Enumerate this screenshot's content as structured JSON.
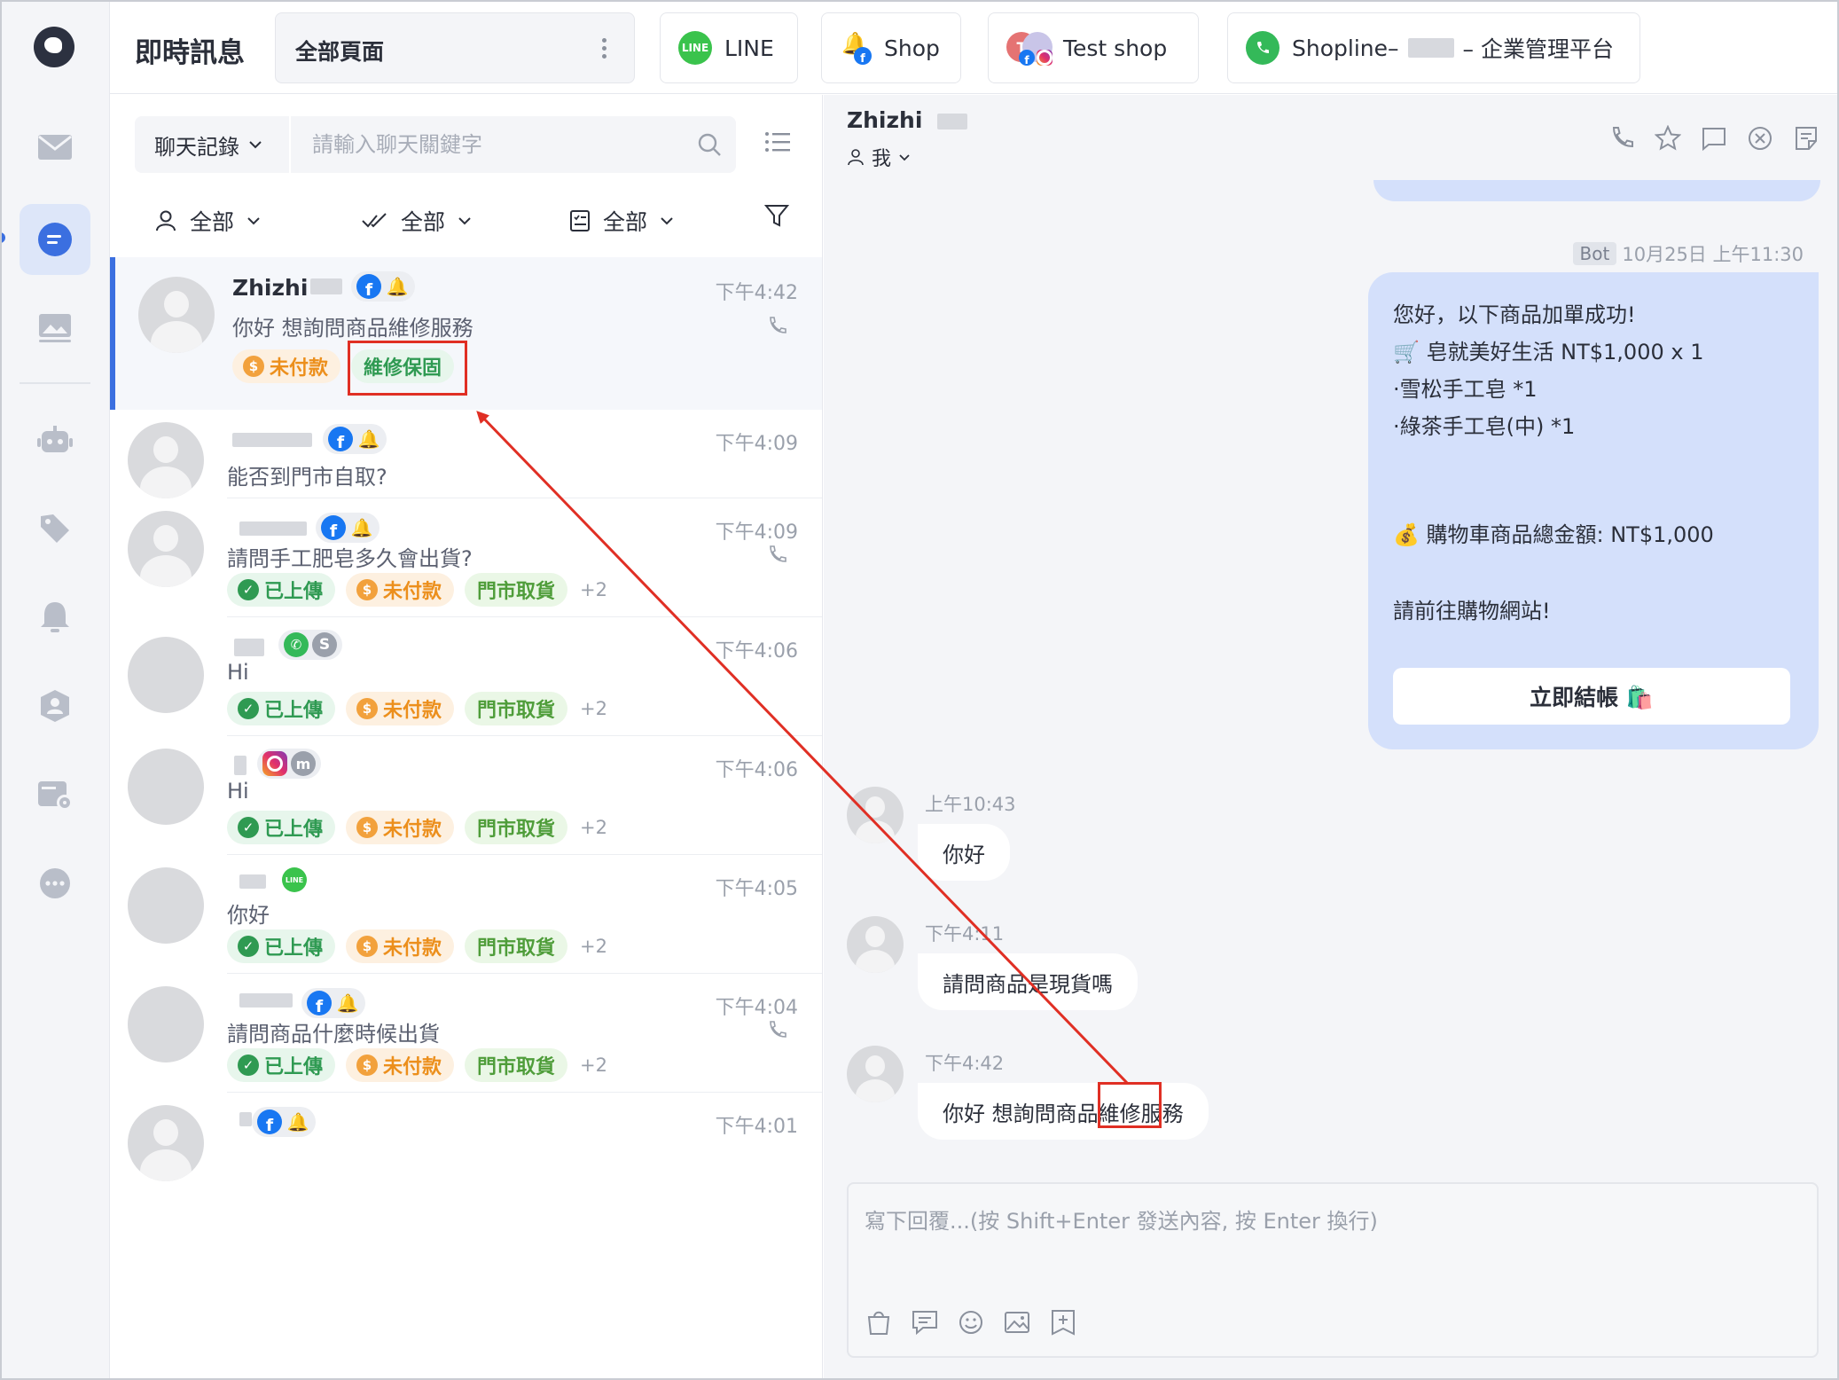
{
  "header": {
    "app_title": "即時訊息",
    "page_selector": "全部頁面",
    "tabs": [
      {
        "label": "LINE"
      },
      {
        "label": "Shop"
      },
      {
        "label": "Test shop"
      },
      {
        "label_prefix": "Shopline–",
        "label_suffix": "– 企業管理平台"
      }
    ]
  },
  "search": {
    "type_label": "聊天記錄",
    "placeholder": "請輸入聊天關鍵字"
  },
  "filters": [
    {
      "label": "全部"
    },
    {
      "label": "全部"
    },
    {
      "label": "全部"
    }
  ],
  "conversations": [
    {
      "name": "Zhizhi",
      "time": "下午4:42",
      "preview": "你好 想詢問商品維修服務",
      "tags": [
        "未付款",
        "維修保固"
      ]
    },
    {
      "name": "",
      "time": "下午4:09",
      "preview": "能否到門市自取?",
      "tags": []
    },
    {
      "name": "",
      "time": "下午4:09",
      "preview": "請問手工肥皂多久會出貨?",
      "tags": [
        "已上傳",
        "未付款",
        "門市取貨"
      ],
      "more": "+2"
    },
    {
      "name": "",
      "time": "下午4:06",
      "preview": "Hi",
      "tags": [
        "已上傳",
        "未付款",
        "門市取貨"
      ],
      "more": "+2"
    },
    {
      "name": "",
      "time": "下午4:06",
      "preview": "Hi",
      "tags": [
        "已上傳",
        "未付款",
        "門市取貨"
      ],
      "more": "+2"
    },
    {
      "name": "",
      "time": "下午4:05",
      "preview": "你好",
      "tags": [
        "已上傳",
        "未付款",
        "門市取貨"
      ],
      "more": "+2"
    },
    {
      "name": "",
      "time": "下午4:04",
      "preview": "請問商品什麼時候出貨",
      "tags": [
        "已上傳",
        "未付款",
        "門市取貨"
      ],
      "more": "+2"
    },
    {
      "name": "",
      "time": "下午4:01",
      "preview": "",
      "tags": []
    }
  ],
  "chat": {
    "contact_name": "Zhizhi",
    "assignee": "我",
    "bot_label": "Bot",
    "bot_time": "10月25日 上午11:30",
    "bot_lines": [
      "您好，以下商品加單成功!",
      "🛒 皂就美好生活 NT$1,000 x 1",
      "·雪松手工皂 *1",
      "·綠茶手工皂(中) *1",
      "💰 購物車商品總金額: NT$1,000",
      "請前往購物網站!"
    ],
    "checkout_button": "立即結帳 🛍️",
    "messages": [
      {
        "time": "上午10:43",
        "text": "你好"
      },
      {
        "time": "下午4:11",
        "text": "請問商品是現貨嗎"
      },
      {
        "time": "下午4:42",
        "text": "你好 想詢問商品維修服務"
      }
    ],
    "composer_placeholder": "寫下回覆...(按 Shift+Enter 發送內容, 按 Enter 換行)"
  },
  "colors": {
    "accent": "#3b6fe0",
    "annotation": "#e02f24",
    "bot_bubble": "#d4e0fb"
  }
}
